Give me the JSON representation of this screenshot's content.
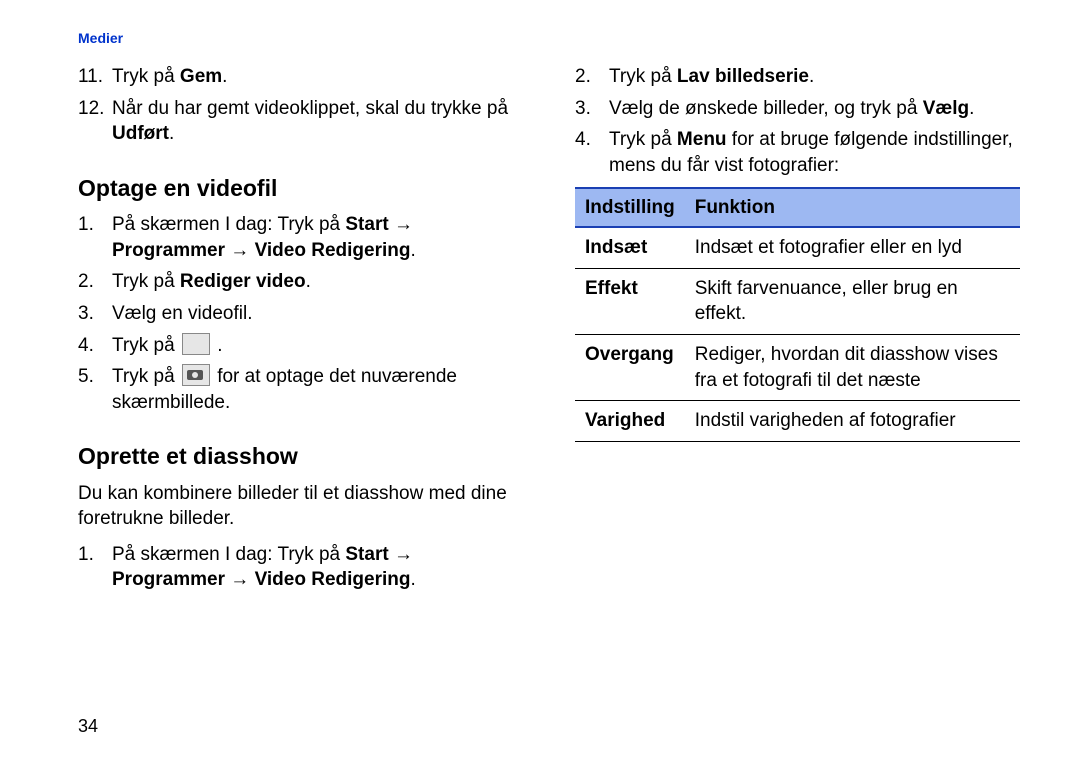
{
  "header": "Medier",
  "page_number": "34",
  "left": {
    "items_top": [
      {
        "num": "11.",
        "pre": "Tryk på ",
        "bold": "Gem",
        "post": "."
      },
      {
        "num": "12.",
        "text": "Når du har gemt videoklippet, skal du trykke på ",
        "bold": "Udført",
        "post": "."
      }
    ],
    "section1_title": "Optage en videofil",
    "section1": {
      "step1": {
        "num": "1.",
        "t1": "På skærmen I dag: Tryk på ",
        "b1": "Start",
        "arrow": " → ",
        "b2": "Programmer",
        "arrow2": " → ",
        "b3": "Video Redigering",
        "end": "."
      },
      "step2": {
        "num": "2.",
        "t": "Tryk på ",
        "b": "Rediger video",
        "end": "."
      },
      "step3": {
        "num": "3.",
        "t": "Vælg en videofil."
      },
      "step4": {
        "num": "4.",
        "t": "Tryk på ",
        "icon": true,
        "end": " ."
      },
      "step5": {
        "num": "5.",
        "t1": "Tryk på ",
        "icon": true,
        "t2": " for at optage det nuværende skærmbillede."
      }
    },
    "section2_title": "Oprette et diasshow",
    "section2_intro": "Du kan kombinere billeder til et diasshow med dine foretrukne billeder.",
    "section2_step1": {
      "num": "1.",
      "t1": "På skærmen I dag: Tryk på ",
      "b1": "Start",
      "arrow": " → ",
      "b2": "Programmer",
      "arrow2": " → ",
      "b3": "Video Redigering",
      "end": "."
    }
  },
  "right": {
    "step2": {
      "num": "2.",
      "t": "Tryk på ",
      "b": "Lav billedserie",
      "end": "."
    },
    "step3": {
      "num": "3.",
      "t1": "Vælg de ønskede billeder, og tryk på ",
      "b": "Vælg",
      "end": "."
    },
    "step4": {
      "num": "4.",
      "t1": "Tryk på ",
      "b": "Menu",
      "t2": " for at bruge følgende indstillinger, mens du får vist fotografier:"
    },
    "table": {
      "head": {
        "c1": "Indstilling",
        "c2": "Funktion"
      },
      "rows": [
        {
          "c1": "Indsæt",
          "c2": "Indsæt et fotografier eller en lyd"
        },
        {
          "c1": "Effekt",
          "c2": "Skift farvenuance, eller brug en effekt."
        },
        {
          "c1": "Overgang",
          "c2": "Rediger, hvordan dit diasshow vises fra et fotografi til det næste"
        },
        {
          "c1": "Varighed",
          "c2": "Indstil varigheden af fotografier"
        }
      ]
    }
  }
}
